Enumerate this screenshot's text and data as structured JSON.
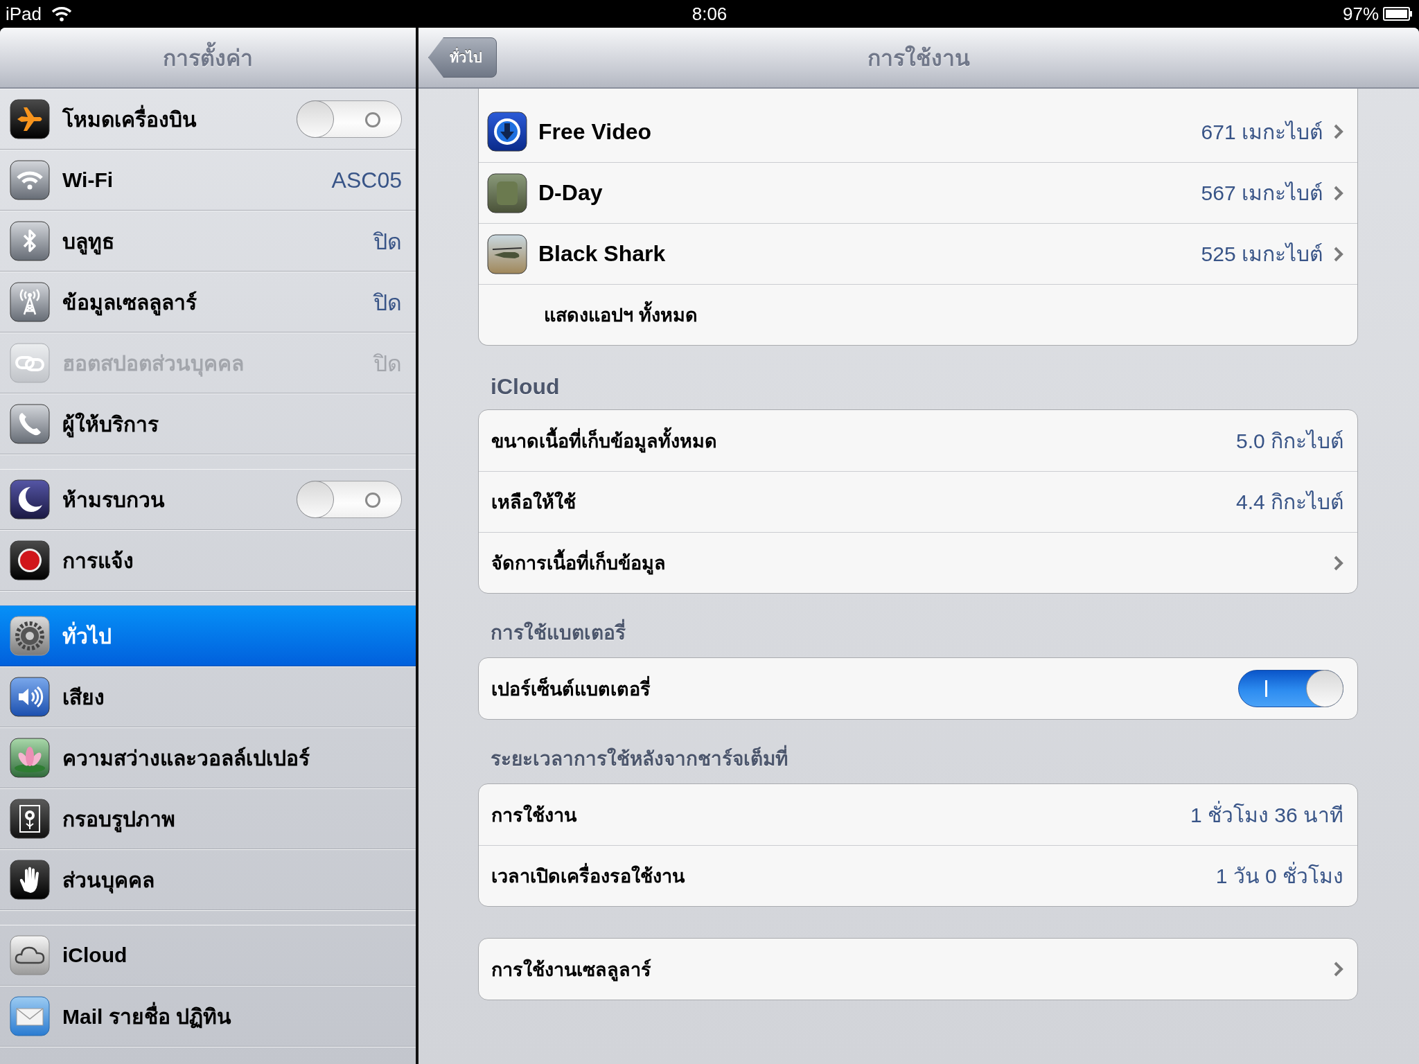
{
  "status_bar": {
    "device": "iPad",
    "time": "8:06",
    "battery": "97%"
  },
  "sidebar": {
    "title": "การตั้งค่า",
    "groups": [
      {
        "items": [
          {
            "label": "โหมดเครื่องบิน",
            "kind": "toggle",
            "on": false,
            "selected": false,
            "disabled": false
          },
          {
            "label": "Wi-Fi",
            "kind": "value",
            "value": "ASC05",
            "selected": false,
            "disabled": false
          },
          {
            "label": "บลูทูธ",
            "kind": "value",
            "value": "ปิด",
            "selected": false,
            "disabled": false
          },
          {
            "label": "ข้อมูลเซลลูลาร์",
            "kind": "value",
            "value": "ปิด",
            "selected": false,
            "disabled": false
          },
          {
            "label": "ฮอตสปอตส่วนบุคคล",
            "kind": "value",
            "value": "ปิด",
            "selected": false,
            "disabled": true
          },
          {
            "label": "ผู้ให้บริการ",
            "kind": "plain",
            "selected": false,
            "disabled": false
          }
        ]
      },
      {
        "items": [
          {
            "label": "ห้ามรบกวน",
            "kind": "toggle",
            "on": false,
            "selected": false,
            "disabled": false
          },
          {
            "label": "การแจ้ง",
            "kind": "plain",
            "selected": false,
            "disabled": false
          }
        ]
      },
      {
        "items": [
          {
            "label": "ทั่วไป",
            "kind": "plain",
            "selected": true,
            "disabled": false
          },
          {
            "label": "เสียง",
            "kind": "plain",
            "selected": false,
            "disabled": false
          },
          {
            "label": "ความสว่างและวอลล์เปเปอร์",
            "kind": "plain",
            "selected": false,
            "disabled": false
          },
          {
            "label": "กรอบรูปภาพ",
            "kind": "plain",
            "selected": false,
            "disabled": false
          },
          {
            "label": "ส่วนบุคคล",
            "kind": "plain",
            "selected": false,
            "disabled": false
          }
        ]
      },
      {
        "items": [
          {
            "label": "iCloud",
            "kind": "plain",
            "selected": false,
            "disabled": false
          },
          {
            "label": "Mail รายชื่อ ปฏิทิน",
            "kind": "plain",
            "selected": false,
            "disabled": false
          }
        ]
      }
    ]
  },
  "detail": {
    "back_button": "ทั่วไป",
    "title": "การใช้งาน",
    "sections": [
      {
        "rows": [
          {
            "kind": "app",
            "label": "Free Video",
            "value": "671 เมกะไบต์",
            "chevron": true
          },
          {
            "kind": "app",
            "label": "D-Day",
            "value": "567 เมกะไบต์",
            "chevron": true
          },
          {
            "kind": "app",
            "label": "Black Shark",
            "value": "525 เมกะไบต์",
            "chevron": true
          },
          {
            "kind": "indented",
            "label": "แสดงแอปฯ ทั้งหมด",
            "chevron": false
          }
        ]
      },
      {
        "header": "iCloud",
        "rows": [
          {
            "kind": "plain",
            "label": "ขนาดเนื้อที่เก็บข้อมูลทั้งหมด",
            "value": "5.0 กิกะไบต์",
            "chevron": false
          },
          {
            "kind": "plain",
            "label": "เหลือให้ใช้",
            "value": "4.4 กิกะไบต์",
            "chevron": false
          },
          {
            "kind": "plain",
            "label": "จัดการเนื้อที่เก็บข้อมูล",
            "chevron": true
          }
        ]
      },
      {
        "header": "การใช้แบตเตอรี่",
        "rows": [
          {
            "kind": "toggle",
            "label": "เปอร์เซ็นต์แบตเตอรี่",
            "on": true,
            "chevron": false
          }
        ]
      },
      {
        "header": "ระยะเวลาการใช้หลังจากชาร์จเต็มที่",
        "rows": [
          {
            "kind": "plain",
            "label": "การใช้งาน",
            "value": "1 ชั่วโมง 36 นาที",
            "chevron": false
          },
          {
            "kind": "plain",
            "label": "เวลาเปิดเครื่องรอใช้งาน",
            "value": "1 วัน 0 ชั่วโมง",
            "chevron": false
          }
        ]
      },
      {
        "rows": [
          {
            "kind": "plain",
            "label": "การใช้งานเซลลูลาร์",
            "chevron": true
          }
        ]
      }
    ]
  }
}
